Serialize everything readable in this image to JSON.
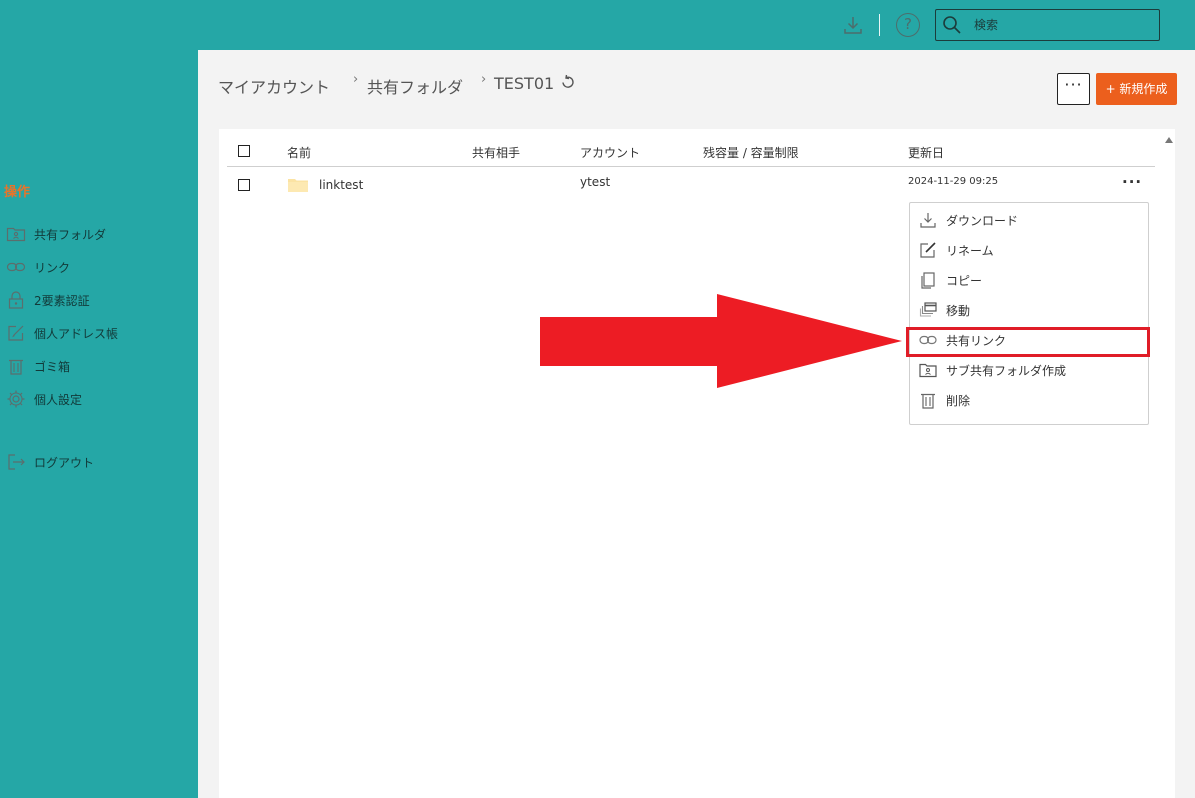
{
  "header": {
    "search_placeholder": "検索",
    "help_label": "?"
  },
  "sidebar": {
    "heading": "操作",
    "items": [
      {
        "label": "共有フォルダ",
        "icon": "shared-folder-icon"
      },
      {
        "label": "リンク",
        "icon": "link-icon"
      },
      {
        "label": "2要素認証",
        "icon": "lock-icon"
      },
      {
        "label": "個人アドレス帳",
        "icon": "edit-icon"
      },
      {
        "label": "ゴミ箱",
        "icon": "trash-icon"
      },
      {
        "label": "個人設定",
        "icon": "gear-icon"
      },
      {
        "label": "ログアウト",
        "icon": "logout-icon"
      }
    ]
  },
  "breadcrumb": {
    "items": [
      "マイアカウント",
      "共有フォルダ",
      "TEST01"
    ],
    "separator": "›"
  },
  "toolbar": {
    "more_label": "···",
    "new_label": "+ 新規作成"
  },
  "table": {
    "columns": [
      "名前",
      "共有相手",
      "アカウント",
      "残容量 / 容量制限",
      "更新日"
    ],
    "rows": [
      {
        "name": "linktest",
        "shared_with": "",
        "account": "ytest",
        "quota": "",
        "updated": "2024-11-29 09:25",
        "more": "···"
      }
    ]
  },
  "context_menu": {
    "items": [
      {
        "label": "ダウンロード",
        "icon": "download-icon"
      },
      {
        "label": "リネーム",
        "icon": "rename-icon"
      },
      {
        "label": "コピー",
        "icon": "copy-icon"
      },
      {
        "label": "移動",
        "icon": "move-icon"
      },
      {
        "label": "共有リンク",
        "icon": "link-icon",
        "highlighted": true
      },
      {
        "label": "サブ共有フォルダ作成",
        "icon": "sub-shared-folder-icon"
      },
      {
        "label": "削除",
        "icon": "trash-icon"
      }
    ]
  },
  "colors": {
    "brand": "#25a7a6",
    "accent": "#ec5f1d",
    "highlight": "#e01d27"
  }
}
